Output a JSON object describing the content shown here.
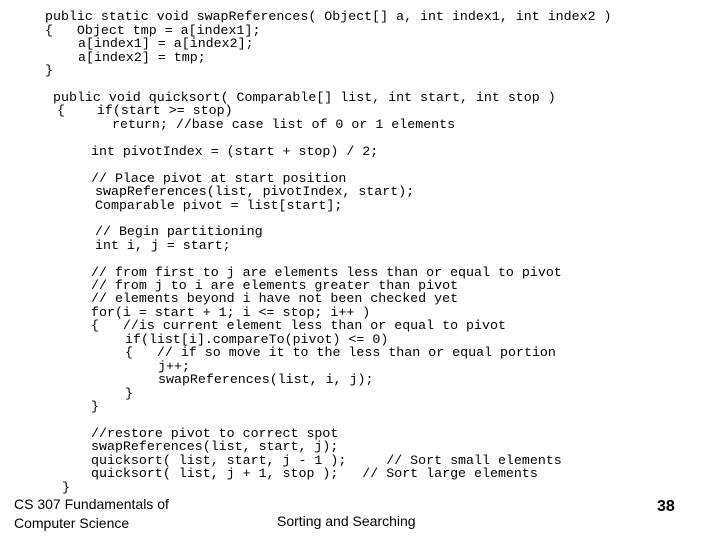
{
  "code": {
    "swap_method": [
      "public static void swapReferences( Object[] a, int index1, int index2 )",
      "{   Object tmp = a[index1];",
      "a[index1] = a[index2];",
      "a[index2] = tmp;",
      "}"
    ],
    "quicksort_header": [
      "public void quicksort( Comparable[] list, int start, int stop )",
      "{    if(start >= stop)",
      "return; //base case list of 0 or 1 elements"
    ],
    "pivot_index": "int pivotIndex = (start + stop) / 2;",
    "place_pivot": [
      "// Place pivot at start position",
      "swapReferences(list, pivotIndex, start);",
      "Comparable pivot = list[start];"
    ],
    "begin_partition": [
      "// Begin partitioning",
      "int i, j = start;"
    ],
    "loop_block": [
      "// from first to j are elements less than or equal to pivot",
      "// from j to i are elements greater than pivot",
      "// elements beyond i have not been checked yet",
      "for(i = start + 1; i <= stop; i++ )",
      "{   //is current element less than or equal to pivot",
      "if(list[i].compareTo(pivot) <= 0)",
      "{   // if so move it to the less than or equal portion",
      "j++;",
      "swapReferences(list, i, j);",
      "}",
      "}"
    ],
    "restore_block": [
      "//restore pivot to correct spot",
      "swapReferences(list, start, j);",
      "quicksort( list, start, j - 1 );     // Sort small elements",
      "quicksort( list, j + 1, stop );   // Sort large elements"
    ],
    "closing_brace": "}"
  },
  "footer": {
    "course_line1": "CS 307 Fundamentals of",
    "course_line2": "Computer Science",
    "topic": "Sorting and Searching",
    "page_number": "38"
  }
}
